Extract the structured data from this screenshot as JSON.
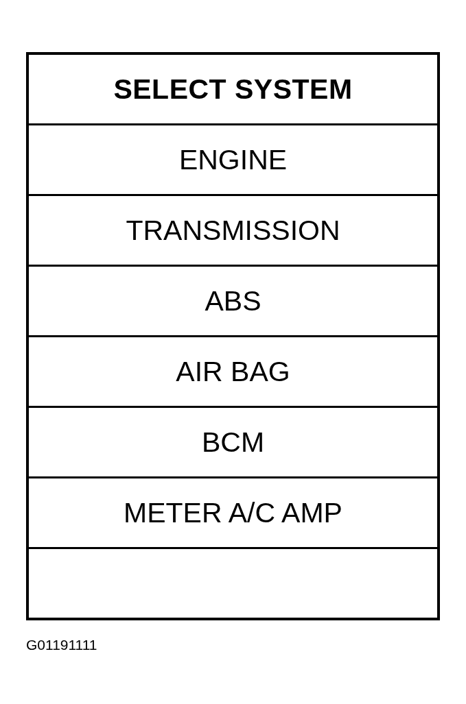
{
  "menu": {
    "title": "SELECT SYSTEM",
    "items": [
      {
        "label": "ENGINE"
      },
      {
        "label": "TRANSMISSION"
      },
      {
        "label": "ABS"
      },
      {
        "label": "AIR BAG"
      },
      {
        "label": "BCM"
      },
      {
        "label": "METER A/C AMP"
      }
    ]
  },
  "figure_code": "G01191111"
}
